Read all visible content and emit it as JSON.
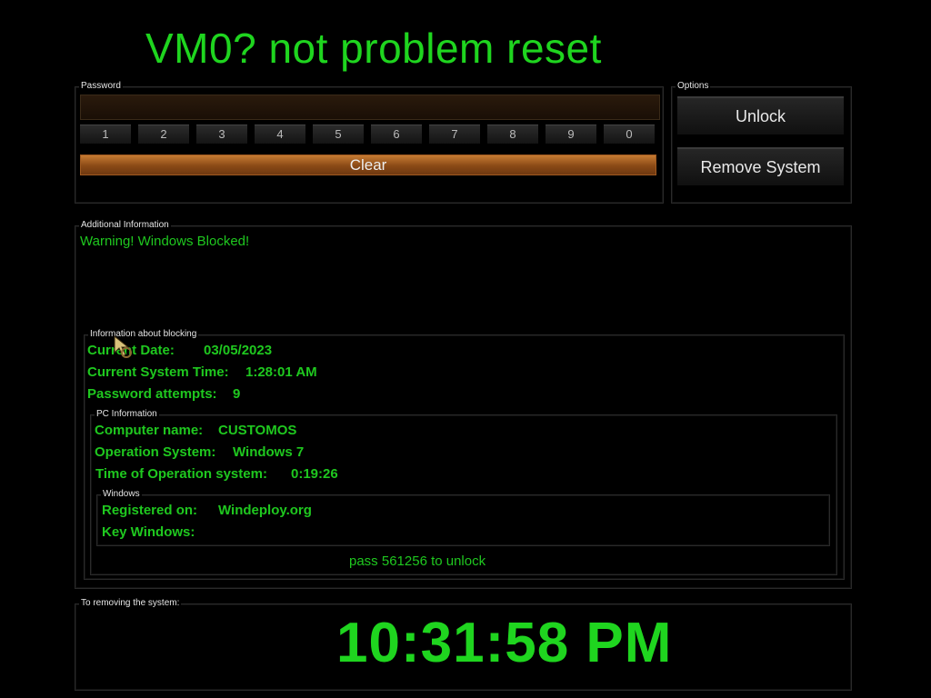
{
  "title": "VM0? not problem reset",
  "password": {
    "legend": "Password",
    "value": "",
    "keys": [
      "1",
      "2",
      "3",
      "4",
      "5",
      "6",
      "7",
      "8",
      "9",
      "0"
    ],
    "clear_label": "Clear"
  },
  "options": {
    "legend": "Options",
    "unlock_label": "Unlock",
    "remove_label": "Remove System"
  },
  "additional": {
    "legend": "Additional Information",
    "warning": "Warning! Windows Blocked!"
  },
  "blocking": {
    "legend": "Information about blocking",
    "date_label": "Current Date:",
    "date_value": "03/05/2023",
    "time_label": "Current System Time:",
    "time_value": "1:28:01 AM",
    "attempts_label": "Password attempts:",
    "attempts_value": "9"
  },
  "pc": {
    "legend": "PC Information",
    "name_label": "Computer name:",
    "name_value": "CUSTOMOS",
    "os_label": "Operation System:",
    "os_value": "Windows 7",
    "uptime_label": "Time of Operation system:",
    "uptime_value": "0:19:26"
  },
  "windows": {
    "legend": "Windows",
    "registered_label": "Registered on:",
    "registered_value": "Windeploy.org",
    "key_label": "Key Windows:",
    "key_value": ""
  },
  "pass_note": "pass 561256 to unlock",
  "removal": {
    "legend": "To removing the system:",
    "clock": "10:31:58 PM"
  },
  "colors": {
    "accent_green": "#1fd51f",
    "clear_button": "#c67a32",
    "background": "#000000"
  }
}
